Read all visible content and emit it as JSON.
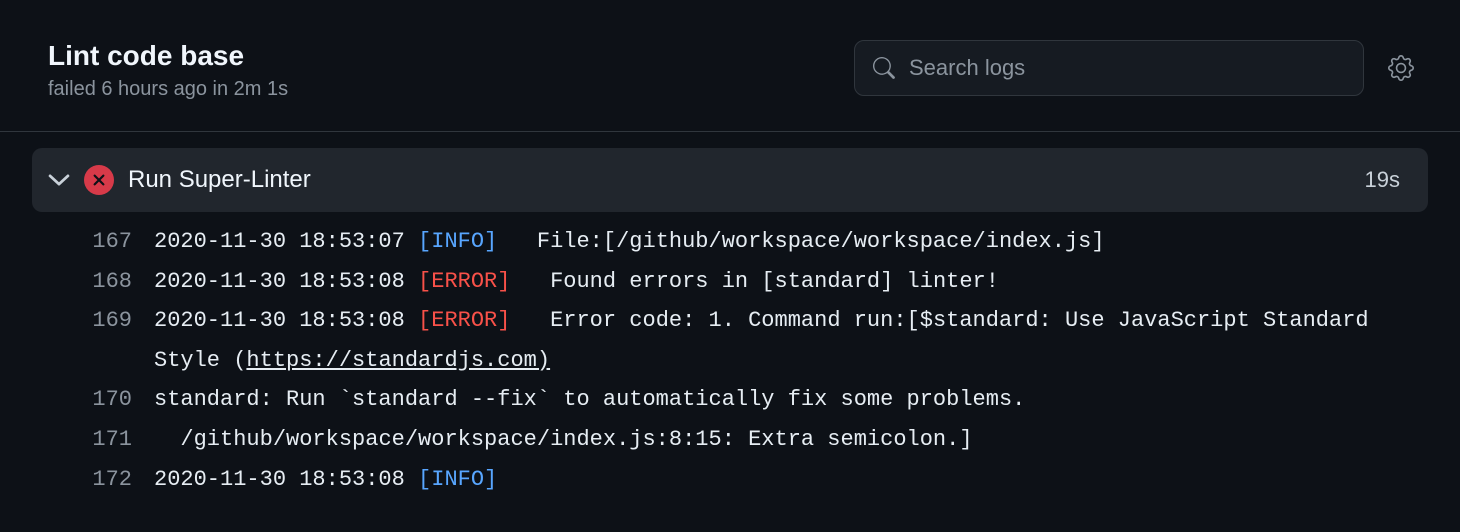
{
  "header": {
    "title": "Lint code base",
    "status": "failed 6 hours ago in 2m 1s",
    "search_placeholder": "Search logs"
  },
  "step": {
    "name": "Run Super-Linter",
    "duration": "19s"
  },
  "lines": [
    {
      "n": "167",
      "ts": "2020-11-30 18:53:07",
      "level": "INFO",
      "msg": "File:[/github/workspace/workspace/index.js]"
    },
    {
      "n": "168",
      "ts": "2020-11-30 18:53:08",
      "level": "ERROR",
      "msg": "Found errors in [standard] linter!"
    },
    {
      "n": "169",
      "ts": "2020-11-30 18:53:08",
      "level": "ERROR",
      "msg": "Error code: 1. Command run:[$standard: Use JavaScript Standard Style (",
      "link": "https://standardjs.com)"
    },
    {
      "n": "170",
      "raw": "standard: Run `standard --fix` to automatically fix some problems."
    },
    {
      "n": "171",
      "raw": "  /github/workspace/workspace/index.js:8:15: Extra semicolon.]"
    },
    {
      "n": "172",
      "ts": "2020-11-30 18:53:08",
      "level": "INFO",
      "msg": ""
    }
  ]
}
